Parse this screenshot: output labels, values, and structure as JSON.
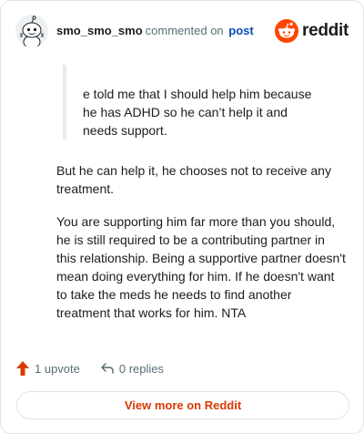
{
  "header": {
    "username": "smo_smo_smo",
    "action": "commented on",
    "post_link": "post",
    "brand_wordmark": "reddit",
    "avatar_icon": "snoo-avatar-icon",
    "brand_icon": "reddit-logo-icon"
  },
  "quote": {
    "lines": [
      "e told me that I should help him because",
      "he has ADHD so he can’t help it and",
      "needs support."
    ]
  },
  "comment": {
    "paragraphs": [
      "But he can help it, he chooses not to receive any treatment.",
      "You are supporting him far more than you should, he is still required to be a contributing partner in this relationship. Being a supportive partner doesn't mean doing everything for him. If he doesn't want to take the meds he needs to find another treatment that works for him. NTA"
    ]
  },
  "footer": {
    "upvotes": "1 upvote",
    "replies": "0 replies",
    "upvote_icon": "upvote-arrow-icon",
    "reply_icon": "reply-arrow-icon"
  },
  "view_more": "View more on Reddit",
  "colors": {
    "brand": "#ff4500",
    "link": "#0a4bb3",
    "muted": "#576f76",
    "cta": "#d93a00"
  }
}
